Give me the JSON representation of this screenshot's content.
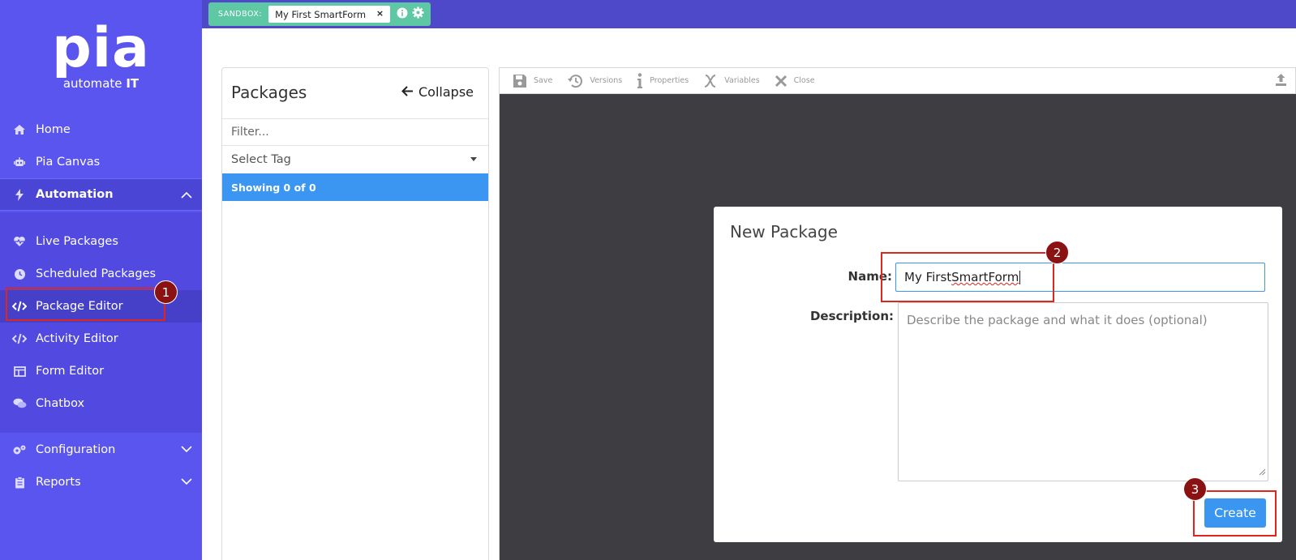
{
  "sidebar": {
    "logo_main": "pia",
    "logo_sub_prefix": "automate ",
    "logo_sub_bold": "IT",
    "items": [
      {
        "label": "Home",
        "icon": "home-icon"
      },
      {
        "label": "Pia Canvas",
        "icon": "robot-icon"
      },
      {
        "label": "Automation",
        "icon": "bolt-icon"
      },
      {
        "label": "Live Packages",
        "icon": "heart-pulse-icon"
      },
      {
        "label": "Scheduled Packages",
        "icon": "clock-icon"
      },
      {
        "label": "Package Editor",
        "icon": "code-icon"
      },
      {
        "label": "Activity Editor",
        "icon": "code-icon"
      },
      {
        "label": "Form Editor",
        "icon": "form-icon"
      },
      {
        "label": "Chatbox",
        "icon": "chat-icon"
      },
      {
        "label": "Configuration",
        "icon": "gears-icon"
      },
      {
        "label": "Reports",
        "icon": "clipboard-icon"
      }
    ]
  },
  "topbar": {
    "sandbox_label": "SANDBOX:",
    "sandbox_name": "My First SmartForm",
    "close_glyph": "×"
  },
  "packages": {
    "title": "Packages",
    "collapse_label": "Collapse",
    "filter_placeholder": "Filter...",
    "tag_select": "Select Tag",
    "showing": "Showing 0 of 0"
  },
  "toolbar": {
    "save": "Save",
    "versions": "Versions",
    "properties": "Properties",
    "variables": "Variables",
    "close": "Close"
  },
  "modal": {
    "title": "New Package",
    "name_label": "Name:",
    "name_part1": "My First ",
    "name_part2": "SmartForm",
    "description_label": "Description:",
    "description_placeholder": "Describe the package and what it does (optional)",
    "create_label": "Create"
  },
  "annotations": {
    "step1": "1",
    "step2": "2",
    "step3": "3"
  },
  "colors": {
    "sidebar": "#5b55f0",
    "topbar": "#4d49c8",
    "sandbox": "#5ec7a3",
    "accent": "#3a96f0",
    "canvas": "#3e3e42",
    "highlight": "#e0261c",
    "badge": "#8b1212"
  }
}
